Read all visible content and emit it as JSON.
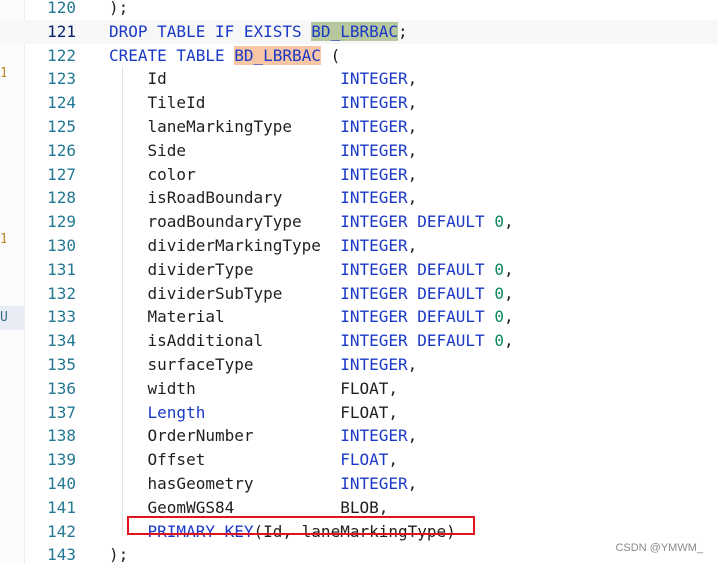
{
  "editor": {
    "gutter_markers": [
      "1",
      "1",
      "U"
    ],
    "lines": [
      {
        "no": "120",
        "parts": [
          {
            "t": "p",
            "v": ");"
          }
        ]
      },
      {
        "no": "121",
        "current": true,
        "parts": [
          {
            "t": "k",
            "v": "DROP TABLE IF EXISTS "
          },
          {
            "t": "sel",
            "v": "BD_LBRBAC"
          },
          {
            "t": "p",
            "v": ";"
          }
        ]
      },
      {
        "no": "122",
        "parts": [
          {
            "t": "k",
            "v": "CREATE TABLE "
          },
          {
            "t": "ref",
            "v": "BD_LBRBAC"
          },
          {
            "t": "p",
            "v": " ("
          }
        ]
      },
      {
        "no": "123",
        "parts": [
          {
            "t": "p",
            "v": "    Id                  "
          },
          {
            "t": "k",
            "v": "INTEGER"
          },
          {
            "t": "p",
            "v": ","
          }
        ]
      },
      {
        "no": "124",
        "parts": [
          {
            "t": "p",
            "v": "    TileId              "
          },
          {
            "t": "k",
            "v": "INTEGER"
          },
          {
            "t": "p",
            "v": ","
          }
        ]
      },
      {
        "no": "125",
        "parts": [
          {
            "t": "p",
            "v": "    laneMarkingType     "
          },
          {
            "t": "k",
            "v": "INTEGER"
          },
          {
            "t": "p",
            "v": ","
          }
        ]
      },
      {
        "no": "126",
        "parts": [
          {
            "t": "p",
            "v": "    Side                "
          },
          {
            "t": "k",
            "v": "INTEGER"
          },
          {
            "t": "p",
            "v": ","
          }
        ]
      },
      {
        "no": "127",
        "parts": [
          {
            "t": "p",
            "v": "    color               "
          },
          {
            "t": "k",
            "v": "INTEGER"
          },
          {
            "t": "p",
            "v": ","
          }
        ]
      },
      {
        "no": "128",
        "parts": [
          {
            "t": "p",
            "v": "    isRoadBoundary      "
          },
          {
            "t": "k",
            "v": "INTEGER"
          },
          {
            "t": "p",
            "v": ","
          }
        ]
      },
      {
        "no": "129",
        "parts": [
          {
            "t": "p",
            "v": "    roadBoundaryType    "
          },
          {
            "t": "k",
            "v": "INTEGER DEFAULT "
          },
          {
            "t": "n",
            "v": "0"
          },
          {
            "t": "p",
            "v": ","
          }
        ]
      },
      {
        "no": "130",
        "parts": [
          {
            "t": "p",
            "v": "    dividerMarkingType  "
          },
          {
            "t": "k",
            "v": "INTEGER"
          },
          {
            "t": "p",
            "v": ","
          }
        ]
      },
      {
        "no": "131",
        "parts": [
          {
            "t": "p",
            "v": "    dividerType         "
          },
          {
            "t": "k",
            "v": "INTEGER DEFAULT "
          },
          {
            "t": "n",
            "v": "0"
          },
          {
            "t": "p",
            "v": ","
          }
        ]
      },
      {
        "no": "132",
        "parts": [
          {
            "t": "p",
            "v": "    dividerSubType      "
          },
          {
            "t": "k",
            "v": "INTEGER DEFAULT "
          },
          {
            "t": "n",
            "v": "0"
          },
          {
            "t": "p",
            "v": ","
          }
        ]
      },
      {
        "no": "133",
        "parts": [
          {
            "t": "p",
            "v": "    Material            "
          },
          {
            "t": "k",
            "v": "INTEGER DEFAULT "
          },
          {
            "t": "n",
            "v": "0"
          },
          {
            "t": "p",
            "v": ","
          }
        ]
      },
      {
        "no": "134",
        "parts": [
          {
            "t": "p",
            "v": "    isAdditional        "
          },
          {
            "t": "k",
            "v": "INTEGER DEFAULT "
          },
          {
            "t": "n",
            "v": "0"
          },
          {
            "t": "p",
            "v": ","
          }
        ]
      },
      {
        "no": "135",
        "parts": [
          {
            "t": "p",
            "v": "    surfaceType         "
          },
          {
            "t": "k",
            "v": "INTEGER"
          },
          {
            "t": "p",
            "v": ","
          }
        ]
      },
      {
        "no": "136",
        "parts": [
          {
            "t": "p",
            "v": "    width               "
          },
          {
            "t": "p",
            "v": "FLOAT,"
          }
        ]
      },
      {
        "no": "137",
        "parts": [
          {
            "t": "p",
            "v": "    "
          },
          {
            "t": "k",
            "v": "Length"
          },
          {
            "t": "p",
            "v": "              FLOAT,"
          }
        ]
      },
      {
        "no": "138",
        "parts": [
          {
            "t": "p",
            "v": "    OrderNumber         "
          },
          {
            "t": "k",
            "v": "INTEGER"
          },
          {
            "t": "p",
            "v": ","
          }
        ]
      },
      {
        "no": "139",
        "parts": [
          {
            "t": "p",
            "v": "    Offset              "
          },
          {
            "t": "k",
            "v": "FLOAT"
          },
          {
            "t": "p",
            "v": ","
          }
        ]
      },
      {
        "no": "140",
        "parts": [
          {
            "t": "p",
            "v": "    hasGeometry         "
          },
          {
            "t": "k",
            "v": "INTEGER"
          },
          {
            "t": "p",
            "v": ","
          }
        ]
      },
      {
        "no": "141",
        "parts": [
          {
            "t": "p",
            "v": "    GeomWGS84           BLOB,"
          }
        ]
      },
      {
        "no": "142",
        "parts": [
          {
            "t": "p",
            "v": "    "
          },
          {
            "t": "k",
            "v": "PRIMARY KEY"
          },
          {
            "t": "p",
            "v": "(Id, laneMarkingType)"
          }
        ]
      },
      {
        "no": "143",
        "parts": [
          {
            "t": "p",
            "v": ");"
          }
        ]
      }
    ]
  },
  "watermark": "CSDN @YMWM_",
  "colors": {
    "keyword": "#1b39c7",
    "number": "#09885a",
    "line_number": "#237893",
    "selection_highlight": "#b7c79e",
    "reference_highlight": "#f7c6a5",
    "annotation_box": "#e0141c"
  },
  "icons": {
    "gutter_marker": "modified-marker-icon"
  }
}
